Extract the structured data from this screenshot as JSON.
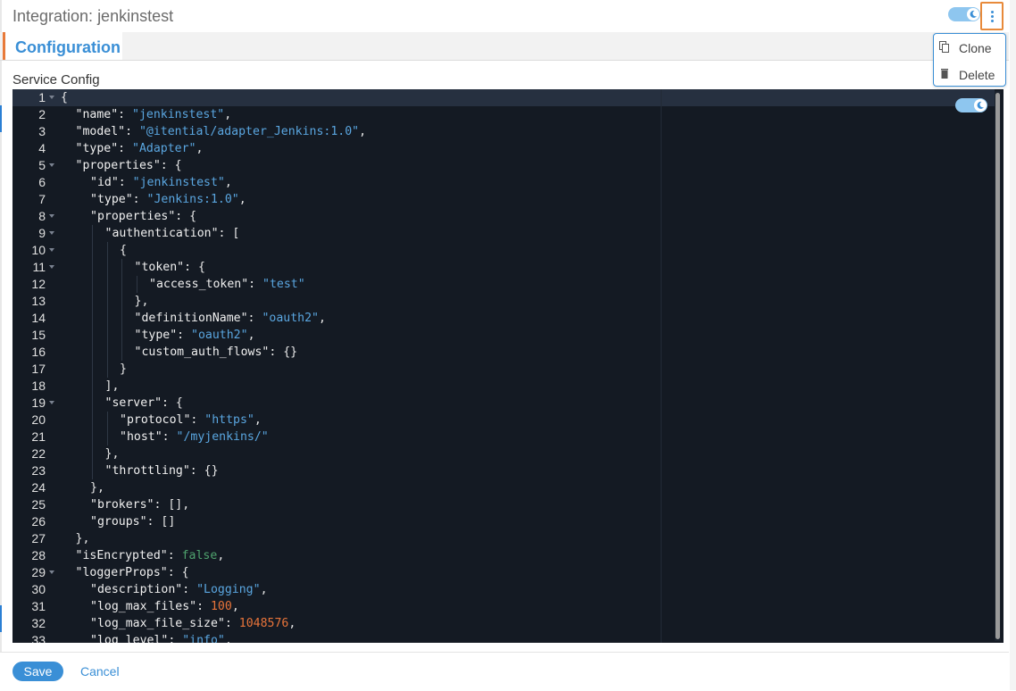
{
  "window": {
    "title": "Integration: jenkinstest"
  },
  "tabs": [
    {
      "label": "Configuration",
      "active": true
    }
  ],
  "section": {
    "label": "Service Config"
  },
  "menu": {
    "items": [
      {
        "label": "Clone",
        "icon": "copy-icon"
      },
      {
        "label": "Delete",
        "icon": "trash-icon"
      }
    ]
  },
  "editor": {
    "lines": [
      {
        "num": "1",
        "indent": 0,
        "fold": true,
        "tokens": [
          {
            "t": "p",
            "v": "{"
          }
        ]
      },
      {
        "num": "2",
        "indent": 1,
        "fold": false,
        "tokens": [
          {
            "t": "k",
            "v": "\"name\""
          },
          {
            "t": "p",
            "v": ": "
          },
          {
            "t": "s",
            "v": "\"jenkinstest\""
          },
          {
            "t": "p",
            "v": ","
          }
        ]
      },
      {
        "num": "3",
        "indent": 1,
        "fold": false,
        "tokens": [
          {
            "t": "k",
            "v": "\"model\""
          },
          {
            "t": "p",
            "v": ": "
          },
          {
            "t": "s",
            "v": "\"@itential/adapter_Jenkins:1.0\""
          },
          {
            "t": "p",
            "v": ","
          }
        ]
      },
      {
        "num": "4",
        "indent": 1,
        "fold": false,
        "tokens": [
          {
            "t": "k",
            "v": "\"type\""
          },
          {
            "t": "p",
            "v": ": "
          },
          {
            "t": "s",
            "v": "\"Adapter\""
          },
          {
            "t": "p",
            "v": ","
          }
        ]
      },
      {
        "num": "5",
        "indent": 1,
        "fold": true,
        "tokens": [
          {
            "t": "k",
            "v": "\"properties\""
          },
          {
            "t": "p",
            "v": ": {"
          }
        ]
      },
      {
        "num": "6",
        "indent": 2,
        "fold": false,
        "tokens": [
          {
            "t": "k",
            "v": "\"id\""
          },
          {
            "t": "p",
            "v": ": "
          },
          {
            "t": "s",
            "v": "\"jenkinstest\""
          },
          {
            "t": "p",
            "v": ","
          }
        ]
      },
      {
        "num": "7",
        "indent": 2,
        "fold": false,
        "tokens": [
          {
            "t": "k",
            "v": "\"type\""
          },
          {
            "t": "p",
            "v": ": "
          },
          {
            "t": "s",
            "v": "\"Jenkins:1.0\""
          },
          {
            "t": "p",
            "v": ","
          }
        ]
      },
      {
        "num": "8",
        "indent": 2,
        "fold": true,
        "tokens": [
          {
            "t": "k",
            "v": "\"properties\""
          },
          {
            "t": "p",
            "v": ": {"
          }
        ]
      },
      {
        "num": "9",
        "indent": 3,
        "fold": true,
        "tokens": [
          {
            "t": "k",
            "v": "\"authentication\""
          },
          {
            "t": "p",
            "v": ": ["
          }
        ]
      },
      {
        "num": "10",
        "indent": 4,
        "fold": true,
        "tokens": [
          {
            "t": "p",
            "v": "{"
          }
        ]
      },
      {
        "num": "11",
        "indent": 5,
        "fold": true,
        "tokens": [
          {
            "t": "k",
            "v": "\"token\""
          },
          {
            "t": "p",
            "v": ": {"
          }
        ]
      },
      {
        "num": "12",
        "indent": 6,
        "fold": false,
        "tokens": [
          {
            "t": "k",
            "v": "\"access_token\""
          },
          {
            "t": "p",
            "v": ": "
          },
          {
            "t": "s",
            "v": "\"test\""
          }
        ]
      },
      {
        "num": "13",
        "indent": 5,
        "fold": false,
        "tokens": [
          {
            "t": "p",
            "v": "},"
          }
        ]
      },
      {
        "num": "14",
        "indent": 5,
        "fold": false,
        "tokens": [
          {
            "t": "k",
            "v": "\"definitionName\""
          },
          {
            "t": "p",
            "v": ": "
          },
          {
            "t": "s",
            "v": "\"oauth2\""
          },
          {
            "t": "p",
            "v": ","
          }
        ]
      },
      {
        "num": "15",
        "indent": 5,
        "fold": false,
        "tokens": [
          {
            "t": "k",
            "v": "\"type\""
          },
          {
            "t": "p",
            "v": ": "
          },
          {
            "t": "s",
            "v": "\"oauth2\""
          },
          {
            "t": "p",
            "v": ","
          }
        ]
      },
      {
        "num": "16",
        "indent": 5,
        "fold": false,
        "tokens": [
          {
            "t": "k",
            "v": "\"custom_auth_flows\""
          },
          {
            "t": "p",
            "v": ": {}"
          }
        ]
      },
      {
        "num": "17",
        "indent": 4,
        "fold": false,
        "tokens": [
          {
            "t": "p",
            "v": "}"
          }
        ]
      },
      {
        "num": "18",
        "indent": 3,
        "fold": false,
        "tokens": [
          {
            "t": "p",
            "v": "],"
          }
        ]
      },
      {
        "num": "19",
        "indent": 3,
        "fold": true,
        "tokens": [
          {
            "t": "k",
            "v": "\"server\""
          },
          {
            "t": "p",
            "v": ": {"
          }
        ]
      },
      {
        "num": "20",
        "indent": 4,
        "fold": false,
        "tokens": [
          {
            "t": "k",
            "v": "\"protocol\""
          },
          {
            "t": "p",
            "v": ": "
          },
          {
            "t": "s",
            "v": "\"https\""
          },
          {
            "t": "p",
            "v": ","
          }
        ]
      },
      {
        "num": "21",
        "indent": 4,
        "fold": false,
        "tokens": [
          {
            "t": "k",
            "v": "\"host\""
          },
          {
            "t": "p",
            "v": ": "
          },
          {
            "t": "s",
            "v": "\"/myjenkins/\""
          }
        ]
      },
      {
        "num": "22",
        "indent": 3,
        "fold": false,
        "tokens": [
          {
            "t": "p",
            "v": "},"
          }
        ]
      },
      {
        "num": "23",
        "indent": 3,
        "fold": false,
        "tokens": [
          {
            "t": "k",
            "v": "\"throttling\""
          },
          {
            "t": "p",
            "v": ": {}"
          }
        ]
      },
      {
        "num": "24",
        "indent": 2,
        "fold": false,
        "tokens": [
          {
            "t": "p",
            "v": "},"
          }
        ]
      },
      {
        "num": "25",
        "indent": 2,
        "fold": false,
        "tokens": [
          {
            "t": "k",
            "v": "\"brokers\""
          },
          {
            "t": "p",
            "v": ": [],"
          }
        ]
      },
      {
        "num": "26",
        "indent": 2,
        "fold": false,
        "tokens": [
          {
            "t": "k",
            "v": "\"groups\""
          },
          {
            "t": "p",
            "v": ": []"
          }
        ]
      },
      {
        "num": "27",
        "indent": 1,
        "fold": false,
        "tokens": [
          {
            "t": "p",
            "v": "},"
          }
        ]
      },
      {
        "num": "28",
        "indent": 1,
        "fold": false,
        "tokens": [
          {
            "t": "k",
            "v": "\"isEncrypted\""
          },
          {
            "t": "p",
            "v": ": "
          },
          {
            "t": "b",
            "v": "false"
          },
          {
            "t": "p",
            "v": ","
          }
        ]
      },
      {
        "num": "29",
        "indent": 1,
        "fold": true,
        "tokens": [
          {
            "t": "k",
            "v": "\"loggerProps\""
          },
          {
            "t": "p",
            "v": ": {"
          }
        ]
      },
      {
        "num": "30",
        "indent": 2,
        "fold": false,
        "tokens": [
          {
            "t": "k",
            "v": "\"description\""
          },
          {
            "t": "p",
            "v": ": "
          },
          {
            "t": "s",
            "v": "\"Logging\""
          },
          {
            "t": "p",
            "v": ","
          }
        ]
      },
      {
        "num": "31",
        "indent": 2,
        "fold": false,
        "tokens": [
          {
            "t": "k",
            "v": "\"log_max_files\""
          },
          {
            "t": "p",
            "v": ": "
          },
          {
            "t": "n",
            "v": "100"
          },
          {
            "t": "p",
            "v": ","
          }
        ]
      },
      {
        "num": "32",
        "indent": 2,
        "fold": false,
        "tokens": [
          {
            "t": "k",
            "v": "\"log_max_file_size\""
          },
          {
            "t": "p",
            "v": ": "
          },
          {
            "t": "n",
            "v": "1048576"
          },
          {
            "t": "p",
            "v": ","
          }
        ]
      },
      {
        "num": "33",
        "indent": 2,
        "fold": false,
        "tokens": [
          {
            "t": "k",
            "v": "\"log_level\""
          },
          {
            "t": "p",
            "v": ": "
          },
          {
            "t": "s",
            "v": "\"info\""
          },
          {
            "t": "p",
            "v": ","
          }
        ]
      }
    ]
  },
  "footer": {
    "save_label": "Save",
    "cancel_label": "Cancel"
  },
  "toggles": {
    "theme_toggle_icon": "moon-icon",
    "editor_theme_toggle_icon": "moon-icon",
    "state": "dark"
  },
  "colors": {
    "accent": "#3a8fd6",
    "tab_marker": "#e87a3a",
    "editor_bg": "#141a23",
    "string": "#5aa6e0",
    "number": "#e8743a",
    "boolean": "#4fa36e"
  }
}
